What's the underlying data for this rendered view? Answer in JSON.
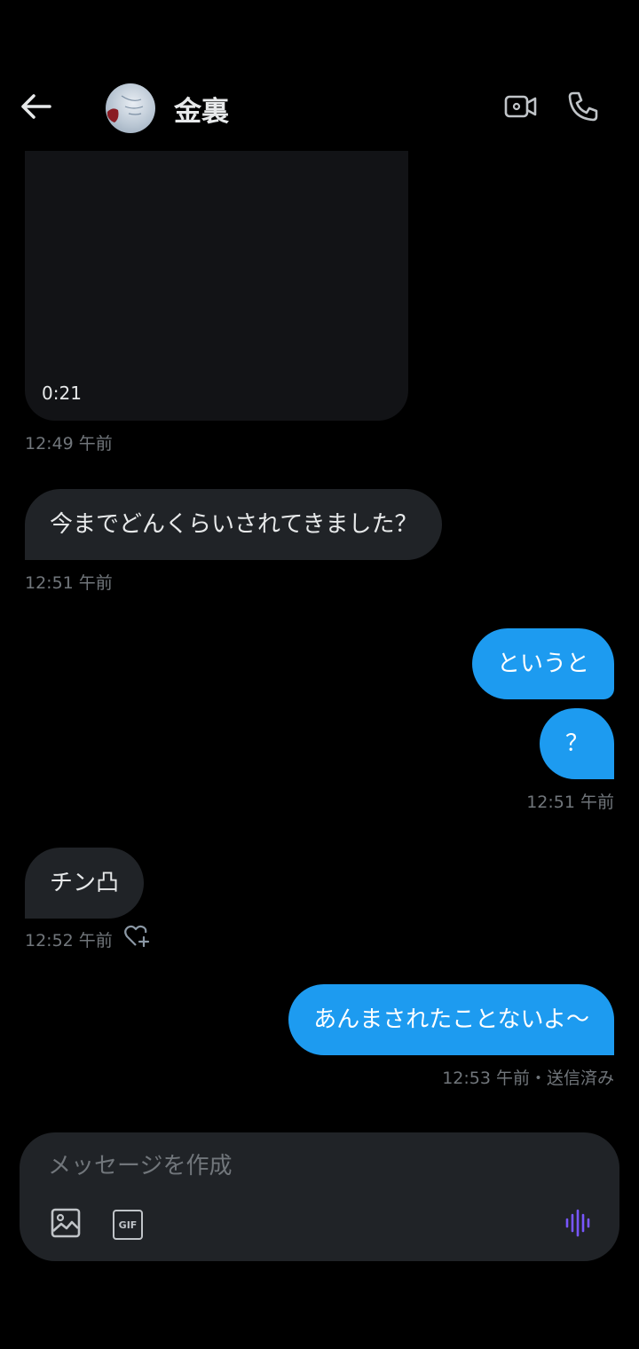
{
  "header": {
    "contact_name": "金裏",
    "icons": {
      "back": "arrow-left-icon",
      "video_call": "video-camera-icon",
      "phone_call": "phone-icon"
    }
  },
  "messages": [
    {
      "type": "video",
      "direction": "received",
      "duration": "0:21",
      "timestamp": "12:49 午前"
    },
    {
      "type": "text",
      "direction": "received",
      "text": "今までどんくらいされてきました？",
      "timestamp": "12:51 午前"
    },
    {
      "type": "text",
      "direction": "sent",
      "text": "というと"
    },
    {
      "type": "text",
      "direction": "sent",
      "text": "？",
      "timestamp": "12:51 午前"
    },
    {
      "type": "text",
      "direction": "received",
      "text": "チン凸",
      "timestamp": "12:52 午前",
      "reaction_icon": "heart-plus-icon"
    },
    {
      "type": "text",
      "direction": "sent",
      "text": "あんまされたことないよ〜",
      "timestamp": "12:53 午前・送信済み"
    }
  ],
  "composer": {
    "placeholder": "メッセージを作成",
    "value": "",
    "gif_label": "GIF",
    "icons": {
      "image": "image-icon",
      "gif": "gif-icon",
      "voice": "voice-waveform-icon"
    }
  },
  "colors": {
    "background": "#000000",
    "received_bubble": "#202327",
    "sent_bubble": "#1d9bf0",
    "timestamp": "#71767b",
    "voice_accent": "#7856ff"
  }
}
